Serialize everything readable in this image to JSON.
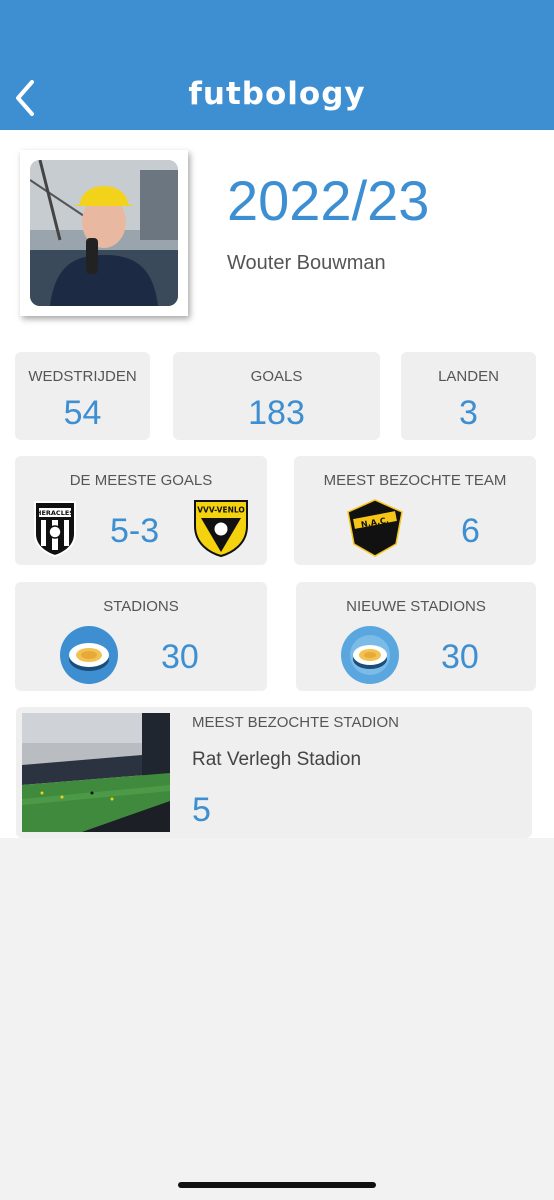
{
  "header": {
    "logo": "futbology",
    "back_icon": "chevron-left-icon",
    "background": "#3d8fd1"
  },
  "profile": {
    "season": "2022/23",
    "name": "Wouter Bouwman"
  },
  "stats": {
    "matches": {
      "label": "WEDSTRIJDEN",
      "value": "54"
    },
    "goals": {
      "label": "GOALS",
      "value": "183"
    },
    "countries": {
      "label": "LANDEN",
      "value": "3"
    }
  },
  "most_goals": {
    "label": "DE MEESTE GOALS",
    "score": "5-3",
    "home_team_crest": "HERACLES",
    "away_team_crest": "VVV-VENLO"
  },
  "most_visited_team": {
    "label": "MEEST BEZOCHTE TEAM",
    "crest": "N.A.C.",
    "value": "6"
  },
  "stadiums": {
    "label": "STADIONS",
    "value": "30",
    "icon": "stadium-icon"
  },
  "new_stadiums": {
    "label": "NIEUWE STADIONS",
    "value": "30",
    "icon": "stadium-icon"
  },
  "most_visited_stadium": {
    "label": "MEEST BEZOCHTE STADION",
    "name": "Rat Verlegh Stadion",
    "value": "5"
  },
  "colors": {
    "accent": "#3d8fd1",
    "card": "#efefef"
  }
}
